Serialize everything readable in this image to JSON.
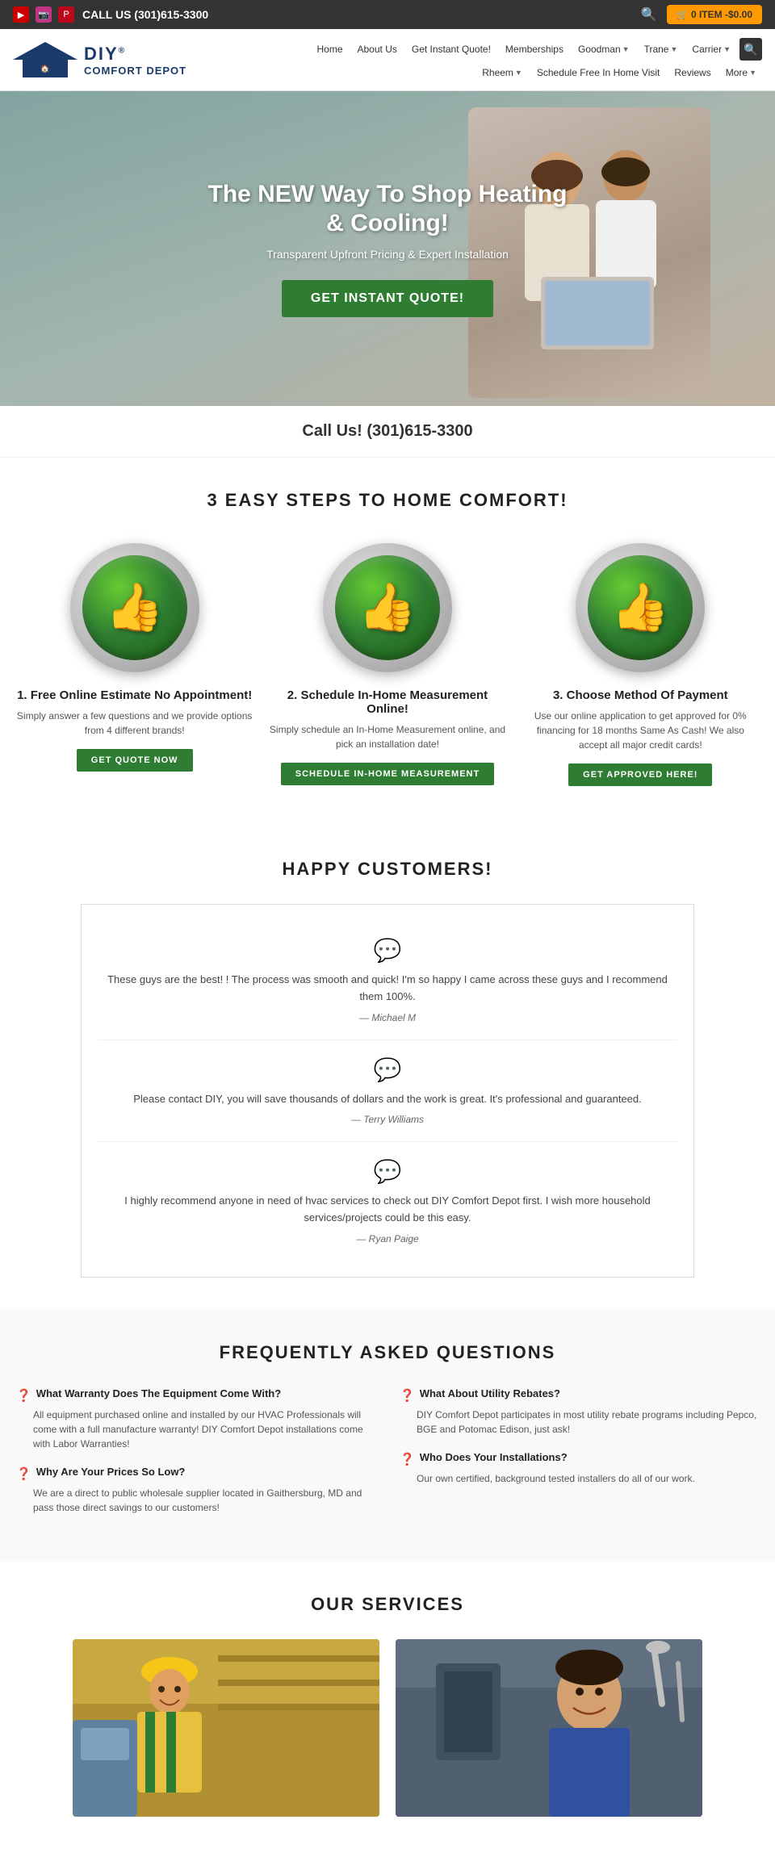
{
  "topbar": {
    "phone": "CALL US (301)615-3300",
    "cart": "0 ITEM -$0.00",
    "social": [
      {
        "name": "youtube",
        "label": "YT"
      },
      {
        "name": "instagram",
        "label": "IG"
      },
      {
        "name": "pinterest",
        "label": "PI"
      }
    ]
  },
  "nav": {
    "logo": {
      "diy": "DIY",
      "registered": "®",
      "comfort": "COMFORT DEPOT"
    },
    "row1": [
      {
        "label": "Home",
        "dropdown": false
      },
      {
        "label": "About Us",
        "dropdown": false
      },
      {
        "label": "Get Instant Quote!",
        "dropdown": false
      },
      {
        "label": "Memberships",
        "dropdown": false
      },
      {
        "label": "Goodman",
        "dropdown": true
      },
      {
        "label": "Trane",
        "dropdown": true
      },
      {
        "label": "Carrier",
        "dropdown": true
      }
    ],
    "row2": [
      {
        "label": "Rheem",
        "dropdown": true
      },
      {
        "label": "Schedule Free In Home Visit",
        "dropdown": false
      },
      {
        "label": "Reviews",
        "dropdown": false
      },
      {
        "label": "More",
        "dropdown": true
      }
    ]
  },
  "hero": {
    "title": "The NEW Way To Shop Heating & Cooling!",
    "subtitle": "Transparent Upfront Pricing & Expert Installation",
    "cta": "GET INSTANT QUOTE!"
  },
  "call": {
    "text": "Call Us! (301)615-3300"
  },
  "steps": {
    "title": "3 EASY STEPS TO HOME COMFORT!",
    "items": [
      {
        "number": "1. Free Online Estimate No Appointment!",
        "desc": "Simply answer a few questions and we provide options from 4 different brands!",
        "btn": "GET QUOTE NOW"
      },
      {
        "number": "2. Schedule In-Home Measurement Online!",
        "desc": "Simply schedule an In-Home Measurement online, and pick an installation date!",
        "btn": "SCHEDULE IN-HOME MEASUREMENT"
      },
      {
        "number": "3. Choose Method Of Payment",
        "desc": "Use our online application to get approved for 0% financing for 18 months Same As Cash! We also accept all major credit cards!",
        "btn": "GET APPROVED HERE!"
      }
    ]
  },
  "testimonials": {
    "title": "HAPPY CUSTOMERS!",
    "items": [
      {
        "text": "These guys are the best! ! The process was smooth and quick! I'm so happy I came across these guys and I recommend them 100%.",
        "author": "— Michael M"
      },
      {
        "text": "Please contact DIY, you will save thousands of dollars and the work is great. It's professional and guaranteed.",
        "author": "— Terry Williams"
      },
      {
        "text": "I highly recommend anyone in need of hvac services to check out DIY Comfort Depot first. I wish more household services/projects could be this easy.",
        "author": "— Ryan Paige"
      }
    ]
  },
  "faq": {
    "title": "FREQUENTLY ASKED QUESTIONS",
    "col1": [
      {
        "question": "What Warranty Does The Equipment Come With?",
        "answer": "All equipment purchased online and installed by our HVAC Professionals will come with a full manufacture warranty! DIY Comfort Depot installations come with Labor Warranties!"
      },
      {
        "question": "Why Are Your Prices So Low?",
        "answer": "We are a direct to public wholesale supplier located in Gaithersburg, MD and pass those direct savings to our customers!"
      }
    ],
    "col2": [
      {
        "question": "What About Utility Rebates?",
        "answer": "DIY Comfort Depot participates in most utility rebate programs including Pepco, BGE and Potomac Edison, just ask!"
      },
      {
        "question": "Who Does Your Installations?",
        "answer": "Our own certified, background tested installers do all of our work."
      }
    ]
  },
  "services": {
    "title": "OUR SERVICES"
  }
}
